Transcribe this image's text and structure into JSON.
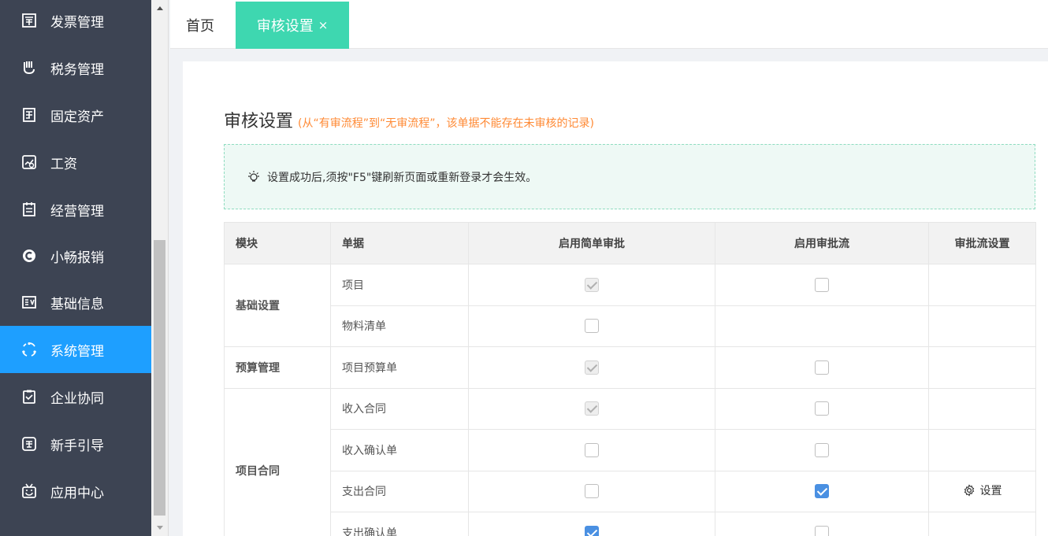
{
  "sidebar": {
    "items": [
      {
        "label": "发票管理",
        "icon": "invoice-icon"
      },
      {
        "label": "税务管理",
        "icon": "tax-icon"
      },
      {
        "label": "固定资产",
        "icon": "asset-icon"
      },
      {
        "label": "工资",
        "icon": "salary-icon"
      },
      {
        "label": "经营管理",
        "icon": "operation-icon"
      },
      {
        "label": "小畅报销",
        "icon": "reimburse-icon"
      },
      {
        "label": "基础信息",
        "icon": "basic-info-icon"
      },
      {
        "label": "系统管理",
        "icon": "system-icon",
        "active": true
      },
      {
        "label": "企业协同",
        "icon": "collab-icon"
      },
      {
        "label": "新手引导",
        "icon": "guide-icon"
      },
      {
        "label": "应用中心",
        "icon": "app-center-icon"
      }
    ]
  },
  "tabs": {
    "home": "首页",
    "active": "审核设置",
    "close": "×"
  },
  "page": {
    "title": "审核设置",
    "note": "(从“有审流程”到“无审流程”，该单据不能存在未审核的记录)",
    "tip": "设置成功后,须按\"F5\"键刷新页面或重新登录才会生效。"
  },
  "table": {
    "headers": [
      "模块",
      "单据",
      "启用简单审批",
      "启用审批流",
      "审批流设置"
    ],
    "modules": [
      "基础设置",
      "预算管理",
      "项目合同"
    ],
    "rows": [
      {
        "doc": "项目",
        "simple": "disabled",
        "flow": "unchecked",
        "setting": ""
      },
      {
        "doc": "物料清单",
        "simple": "unchecked",
        "flow": "none",
        "setting": ""
      },
      {
        "doc": "项目预算单",
        "simple": "disabled",
        "flow": "unchecked",
        "setting": ""
      },
      {
        "doc": "收入合同",
        "simple": "disabled",
        "flow": "unchecked",
        "setting": ""
      },
      {
        "doc": "收入确认单",
        "simple": "unchecked",
        "flow": "unchecked",
        "setting": ""
      },
      {
        "doc": "支出合同",
        "simple": "unchecked",
        "flow": "checked",
        "setting": "设置"
      },
      {
        "doc": "支出确认单",
        "simple": "checked",
        "flow": "unchecked",
        "setting": ""
      }
    ]
  },
  "colors": {
    "sidebar_bg": "#3d4453",
    "active_nav": "#1e9fff",
    "active_tab": "#3ed7b0",
    "note": "#ff8a35",
    "checkbox_checked": "#4a90e2"
  }
}
